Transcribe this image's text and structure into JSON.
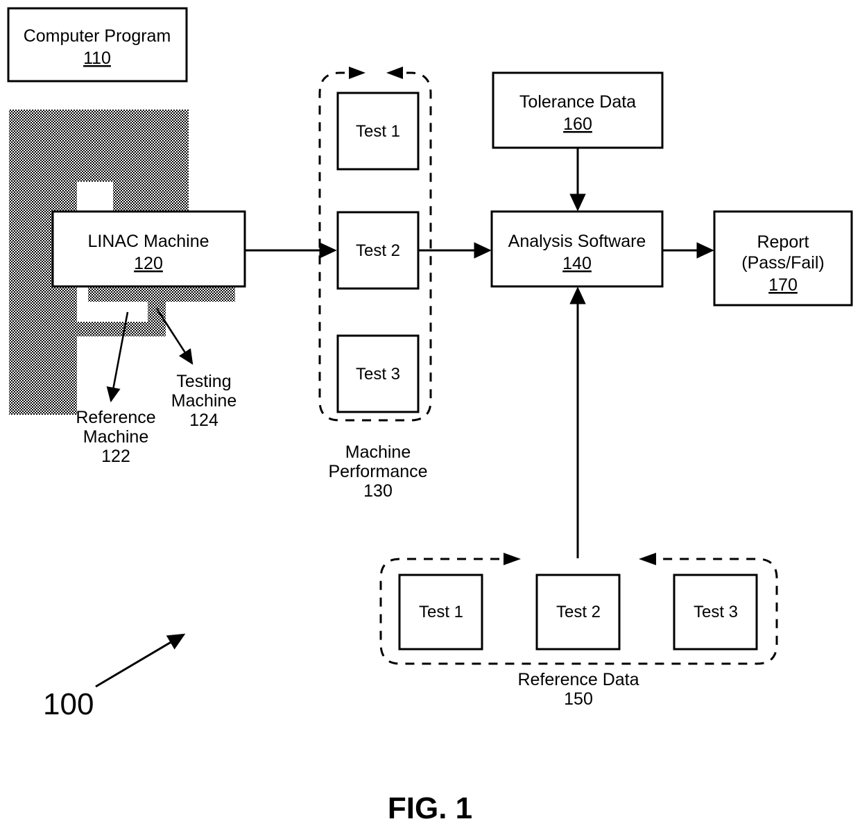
{
  "figure": {
    "caption": "FIG. 1",
    "system_label": "100"
  },
  "boxes": {
    "computer_program": {
      "title": "Computer Program",
      "ref": "110"
    },
    "linac_machine": {
      "title": "LINAC Machine",
      "ref": "120"
    },
    "tolerance_data": {
      "title": "Tolerance Data",
      "ref": "160"
    },
    "analysis_software": {
      "title": "Analysis Software",
      "ref": "140"
    },
    "report": {
      "line1": "Report",
      "line2": "(Pass/Fail)",
      "ref": "170"
    }
  },
  "callouts": {
    "reference_machine": {
      "line1": "Reference",
      "line2": "Machine",
      "ref": "122"
    },
    "testing_machine": {
      "line1": "Testing",
      "line2": "Machine",
      "ref": "124"
    }
  },
  "machine_performance": {
    "label_line1": "Machine",
    "label_line2": "Performance",
    "ref": "130",
    "tests": [
      {
        "label": "Test 1"
      },
      {
        "label": "Test 2"
      },
      {
        "label": "Test 3"
      }
    ]
  },
  "reference_data": {
    "label": "Reference Data",
    "ref": "150",
    "tests": [
      {
        "label": "Test 1"
      },
      {
        "label": "Test 2"
      },
      {
        "label": "Test 3"
      }
    ]
  },
  "colors": {
    "stroke": "#000000",
    "fill": "#ffffff",
    "hatch": "#000000"
  }
}
